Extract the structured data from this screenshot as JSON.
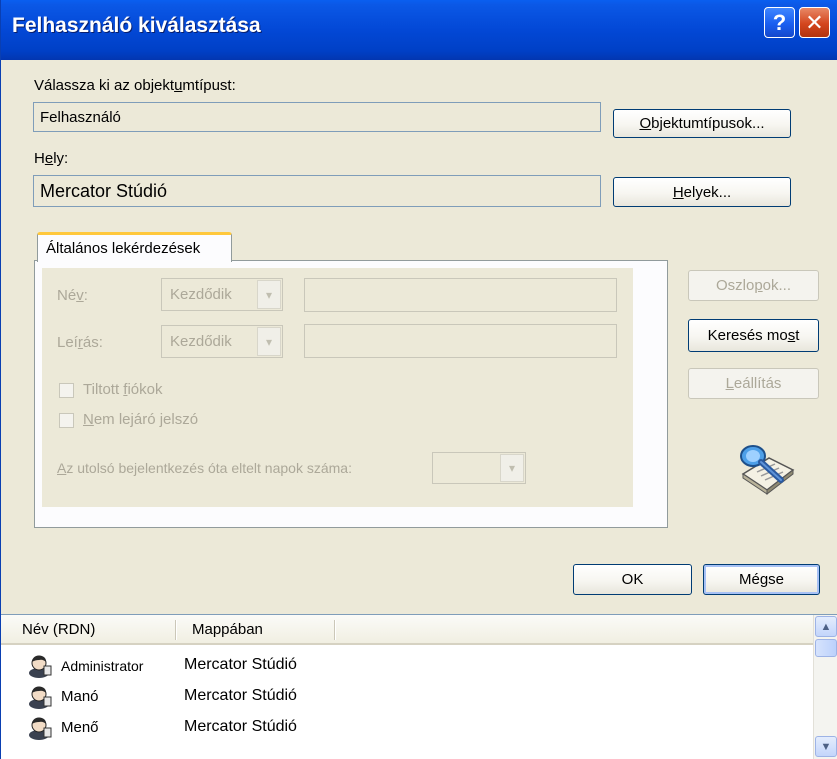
{
  "window": {
    "title": "Felhasználó kiválasztása",
    "help_glyph": "?",
    "close_glyph": "✕"
  },
  "object_type": {
    "label_pre": "Válassza ki az objekt",
    "label_key": "u",
    "label_post": "mtípust:",
    "value": "Felhasználó",
    "button_key": "O",
    "button_rest": "bjektumtípusok..."
  },
  "location": {
    "label_pre": "H",
    "label_key": "e",
    "label_post": "ly:",
    "value": "Mercator Stúdió",
    "button_key": "H",
    "button_rest": "elyek..."
  },
  "tab": {
    "label": "Általános lekérdezések"
  },
  "query": {
    "name_label_pre": "Né",
    "name_label_key": "v",
    "name_label_post": ":",
    "name_mode": "Kezdődik",
    "desc_label_pre": "Leí",
    "desc_label_key": "r",
    "desc_label_post": "ás:",
    "desc_mode": "Kezdődik",
    "disabled_accounts_pre": "Tiltott ",
    "disabled_accounts_key": "f",
    "disabled_accounts_post": "iókok",
    "nonexpiring_key": "N",
    "nonexpiring_post": "em lejáró jelszó",
    "days_label_key": "A",
    "days_label_post": "z utolsó bejelentkezés óta eltelt napok száma:",
    "combo_arrow": "▾"
  },
  "buttons": {
    "columns_pre": "Oszlo",
    "columns_key": "p",
    "columns_post": "ok...",
    "search_pre": "Keresés mo",
    "search_key": "s",
    "search_post": "t",
    "stop_key": "L",
    "stop_post": "eállítás",
    "ok": "OK",
    "cancel": "Mégse"
  },
  "results": {
    "columns": [
      "Név (RDN)",
      "Mappában"
    ],
    "rows": [
      {
        "name": "Administrator",
        "folder": "Mercator Stúdió"
      },
      {
        "name": "Manó",
        "folder": "Mercator Stúdió"
      },
      {
        "name": "Menő",
        "folder": "Mercator Stúdió"
      }
    ],
    "scroll_up": "▲",
    "scroll_down": "▼"
  }
}
